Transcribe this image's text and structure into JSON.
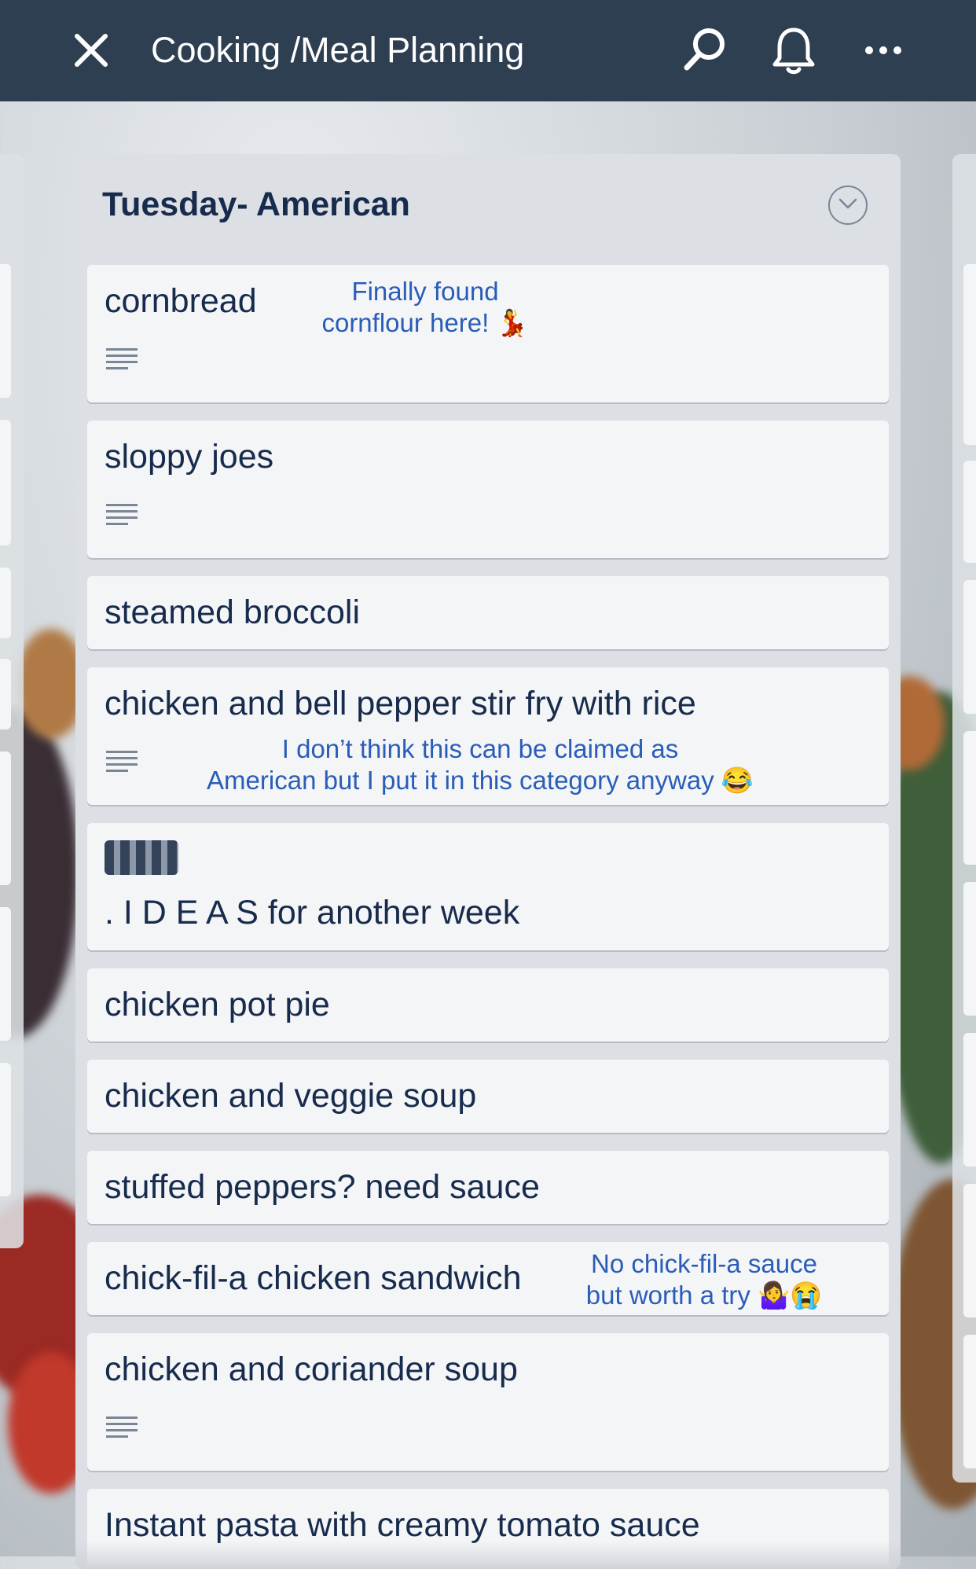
{
  "app": {
    "board_title": "Cooking /Meal Planning",
    "icons": [
      "close-icon",
      "search-icon",
      "bell-icon",
      "more-icon"
    ]
  },
  "list": {
    "title": "Tuesday- American",
    "cards": [
      {
        "title": "cornbread",
        "note_line1": "Finally found",
        "note_line2": "cornflour here! 💃"
      },
      {
        "title": "sloppy joes"
      },
      {
        "title": "steamed broccoli"
      },
      {
        "title": "chicken and bell pepper stir fry with rice",
        "note_line1": "I don’t think this can be claimed as",
        "note_line2": "American but I put it in this category anyway 😂"
      },
      {
        "title": ". I D E A S for another week"
      },
      {
        "title": "chicken pot pie"
      },
      {
        "title": "chicken and veggie soup"
      },
      {
        "title": "stuffed peppers? need sauce"
      },
      {
        "title": "chick-fil-a chicken sandwich",
        "note_line1": "No chick-fil-a sauce",
        "note_line2": "but worth a try 🤷‍♀️😭"
      },
      {
        "title": "chicken and coriander soup"
      },
      {
        "title": "Instant pasta with creamy tomato sauce"
      }
    ]
  },
  "colors": {
    "topbar": "#2e3f52",
    "note_text": "#2a5db8",
    "card_bg": "#f4f5f7",
    "list_bg": "#dcdfe3"
  }
}
